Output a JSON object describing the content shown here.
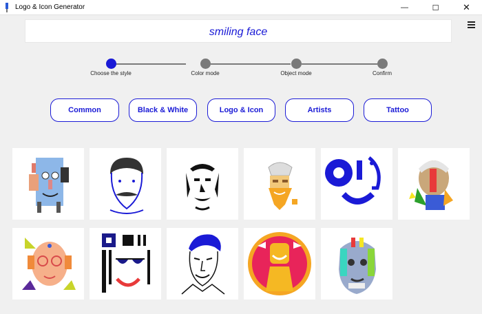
{
  "window": {
    "title": "Logo & Icon Generator",
    "controls": {
      "minimize": "—",
      "maximize": "☐",
      "close": "✕"
    }
  },
  "prompt": {
    "text": "smiling face"
  },
  "menu": {
    "icon": "hamburger-menu-icon"
  },
  "steps": [
    {
      "label": "Choose the style",
      "active": true
    },
    {
      "label": "Color mode",
      "active": false
    },
    {
      "label": "Object mode",
      "active": false
    },
    {
      "label": "Confirm",
      "active": false
    }
  ],
  "styles": [
    "Common",
    "Black & White",
    "Logo & Icon",
    "Artists",
    "Tattoo"
  ],
  "gallery": {
    "rows": [
      [
        "face-portrait-cubist-blue",
        "face-portrait-mustache-lineart",
        "face-portrait-stencil-bw",
        "face-portrait-orange-beard",
        "face-portrait-blue-picasso",
        "face-portrait-colorful-patchwork"
      ],
      [
        "face-portrait-bald-glasses",
        "face-portrait-geometric-bauhaus",
        "face-portrait-blue-sketch",
        "face-portrait-red-circle-smile",
        "face-portrait-colorful-pop-art"
      ]
    ]
  },
  "colors": {
    "accent": "#1a1ad6",
    "background": "#f0f0f0",
    "inactive_step": "#7a7a7a"
  }
}
